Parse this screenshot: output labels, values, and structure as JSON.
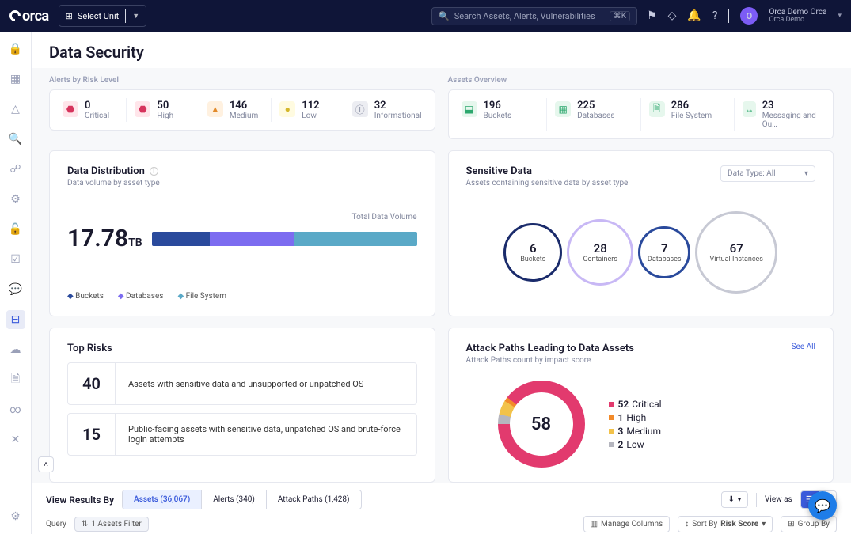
{
  "header": {
    "logo": "orca",
    "unit_prefix": "⊞",
    "unit_label": "Select Unit",
    "search_placeholder": "Search Assets, Alerts, Vulnerabilities",
    "search_kbd": "⌘K",
    "user_name": "Orca Demo Orca",
    "user_org": "Orca Demo",
    "avatar_initial": "O"
  },
  "page": {
    "title": "Data Security"
  },
  "alerts_label": "Alerts by Risk Level",
  "alerts": [
    {
      "count": "0",
      "label": "Critical",
      "cls": "crit",
      "glyph": "⬣"
    },
    {
      "count": "50",
      "label": "High",
      "cls": "high",
      "glyph": "⬣"
    },
    {
      "count": "146",
      "label": "Medium",
      "cls": "med",
      "glyph": "▲"
    },
    {
      "count": "112",
      "label": "Low",
      "cls": "low",
      "glyph": "●"
    },
    {
      "count": "32",
      "label": "Informational",
      "cls": "info",
      "glyph": "ⓘ"
    }
  ],
  "assets_label": "Assets Overview",
  "assets": [
    {
      "count": "196",
      "label": "Buckets",
      "glyph": "⬓"
    },
    {
      "count": "225",
      "label": "Databases",
      "glyph": "▦"
    },
    {
      "count": "286",
      "label": "File System",
      "glyph": "🗎"
    },
    {
      "count": "23",
      "label": "Messaging and Qu…",
      "glyph": "↔"
    }
  ],
  "dist": {
    "title": "Data Distribution",
    "sub": "Data volume by asset type",
    "total_label": "Total Data Volume",
    "value": "17.78",
    "unit": "TB",
    "legend": [
      "Buckets",
      "Databases",
      "File System"
    ]
  },
  "sens": {
    "title": "Sensitive Data",
    "sub": "Assets containing sensitive data by asset type",
    "dropdown": "Data Type: All",
    "bubbles": [
      {
        "n": "6",
        "l": "Buckets"
      },
      {
        "n": "28",
        "l": "Containers"
      },
      {
        "n": "7",
        "l": "Databases"
      },
      {
        "n": "67",
        "l": "Virtual Instances"
      }
    ]
  },
  "toprisks": {
    "title": "Top Risks",
    "items": [
      {
        "n": "40",
        "d": "Assets with sensitive data and unsupported or unpatched OS"
      },
      {
        "n": "15",
        "d": "Public-facing assets with sensitive data, unpatched OS and brute-force login attempts"
      }
    ]
  },
  "attack": {
    "title": "Attack Paths Leading to Data Assets",
    "sub": "Attack Paths count by impact score",
    "seeall": "See All",
    "total": "58",
    "legend": [
      {
        "n": "52",
        "l": "Critical",
        "cls": "c"
      },
      {
        "n": "1",
        "l": "High",
        "cls": "h"
      },
      {
        "n": "3",
        "l": "Medium",
        "cls": "m"
      },
      {
        "n": "2",
        "l": "Low",
        "cls": "l"
      }
    ]
  },
  "bottom": {
    "view_label": "View Results By",
    "tabs": [
      {
        "l": "Assets (36,067)",
        "active": true
      },
      {
        "l": "Alerts (340)"
      },
      {
        "l": "Attack Paths (1,428)"
      }
    ],
    "viewas": "View as",
    "query": "Query",
    "filter": "1 Assets Filter",
    "manage": "Manage Columns",
    "sort_prefix": "Sort By",
    "sort_value": "Risk Score",
    "group": "Group By"
  },
  "chart_data": [
    {
      "type": "bar",
      "title": "Data Distribution — Total Data Volume",
      "total": "17.78 TB",
      "series": [
        {
          "name": "volume_tb",
          "values": [
            3.9,
            5.7,
            8.2
          ]
        }
      ],
      "categories": [
        "Buckets",
        "Databases",
        "File System"
      ],
      "note": "segment widths estimated from pixel proportions; exact per-category TB not labeled"
    },
    {
      "type": "pie",
      "title": "Attack Paths Leading to Data Assets",
      "total": 58,
      "categories": [
        "Critical",
        "High",
        "Medium",
        "Low"
      ],
      "values": [
        52,
        1,
        3,
        2
      ]
    },
    {
      "type": "scatter",
      "title": "Sensitive Data — assets containing sensitive data by asset type",
      "categories": [
        "Buckets",
        "Containers",
        "Databases",
        "Virtual Instances"
      ],
      "values": [
        6,
        28,
        7,
        67
      ]
    }
  ]
}
